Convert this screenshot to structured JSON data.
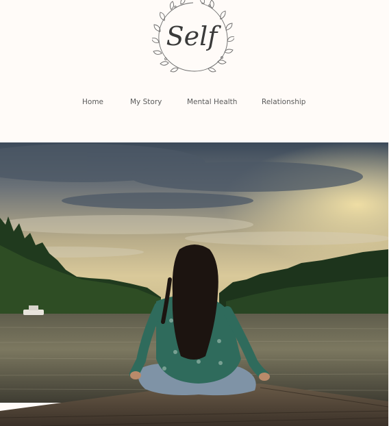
{
  "site": {
    "logo_text": "Self",
    "nav_items": [
      {
        "label": "Home"
      },
      {
        "label": "My Story"
      },
      {
        "label": "Mental Health"
      },
      {
        "label": "Relationship"
      }
    ]
  },
  "hero": {
    "image": "woman-meditating-on-dock-at-lake-sunset"
  },
  "colors": {
    "page_background": "#fffbf8",
    "nav_text": "#5a5a5a",
    "logo_line": "#555555"
  }
}
